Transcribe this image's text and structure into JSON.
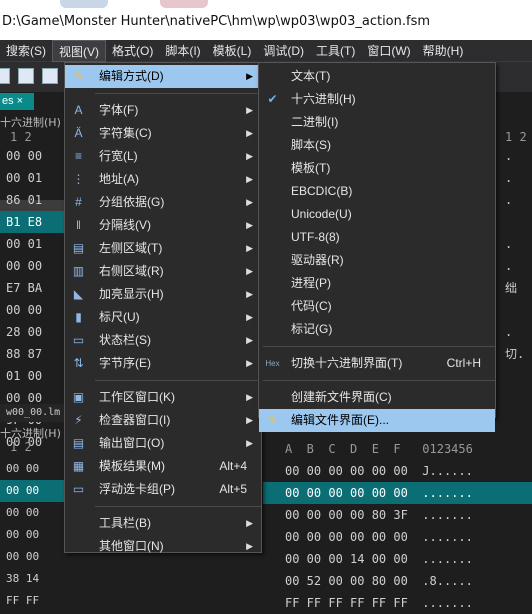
{
  "window": {
    "path": "D:\\Game\\Monster Hunter\\nativePC\\hm\\wp\\wp03\\wp03_action.fsm"
  },
  "menubar": [
    "搜索(S)",
    "视图(V)",
    "格式(O)",
    "脚本(I)",
    "模板(L)",
    "调试(D)",
    "工具(T)",
    "窗口(W)",
    "帮助(H)"
  ],
  "doc_tab": "es ×",
  "top_pane": {
    "label": "十六进制(H)",
    "col_header": "1  2",
    "rows": [
      "00 00",
      "00 01",
      "86 01",
      "B1 E8",
      "00 01",
      "00 00",
      "E7 BA",
      "00 00",
      "28 00",
      "88 87",
      "01 00",
      "00 00",
      "9F 00",
      "00 00"
    ],
    "right_chars": [
      ".",
      ".",
      ".",
      "",
      ".",
      ".",
      "绌",
      "",
      ".",
      "切.",
      "",
      "",
      "",
      ""
    ],
    "right_header": "1 2"
  },
  "file_tab": "w00_00.lm",
  "bottom_pane": {
    "label": "十六进制(H)",
    "left_header": "1  2",
    "left_rows": [
      "00 00",
      "00 00",
      "00 00",
      "00 00",
      "00 00",
      "38 14",
      "FF FF"
    ],
    "header": "A  B  C  D  E  F   0123456",
    "rows": [
      "00 00 00 00 00 00  J......",
      "00 00 00 00 00 00  .......",
      "00 00 00 00 80 3F  .......",
      "00 00 00 00 00 00  .......",
      "00 00 00 14 00 00  .......",
      "00 52 00 00 80 00  .8.....",
      "FF FF FF FF FF FF  ......."
    ]
  },
  "view_menu": {
    "items": [
      {
        "label": "编辑方式(D)",
        "icon": "pencil-icon",
        "submenu": true
      },
      {
        "sep": true
      },
      {
        "label": "字体(F)",
        "icon": "font-icon",
        "submenu": true
      },
      {
        "label": "字符集(C)",
        "icon": "charset-icon",
        "submenu": true
      },
      {
        "label": "行宽(L)",
        "icon": "line-width-icon",
        "submenu": true
      },
      {
        "label": "地址(A)",
        "icon": "address-icon",
        "submenu": true
      },
      {
        "label": "分组依据(G)",
        "icon": "group-icon",
        "submenu": true
      },
      {
        "label": "分隔线(V)",
        "icon": "divider-icon",
        "submenu": true
      },
      {
        "label": "左侧区域(T)",
        "icon": "left-area-icon",
        "submenu": true
      },
      {
        "label": "右侧区域(R)",
        "icon": "right-area-icon",
        "submenu": true
      },
      {
        "label": "加亮显示(H)",
        "icon": "highlight-icon",
        "submenu": true
      },
      {
        "label": "标尺(U)",
        "icon": "ruler-icon",
        "submenu": true
      },
      {
        "label": "状态栏(S)",
        "icon": "statusbar-icon",
        "submenu": true
      },
      {
        "label": "字节序(E)",
        "icon": "byteorder-icon",
        "submenu": true
      },
      {
        "sep": true
      },
      {
        "label": "工作区窗口(K)",
        "icon": "workspace-icon",
        "submenu": true
      },
      {
        "label": "检查器窗口(I)",
        "icon": "inspector-icon",
        "submenu": true
      },
      {
        "label": "输出窗口(O)",
        "icon": "output-icon",
        "submenu": true
      },
      {
        "label": "模板结果(M)",
        "icon": "template-results-icon",
        "shortcut": "Alt+4"
      },
      {
        "label": "浮动选卡组(P)",
        "icon": "floating-tabs-icon",
        "shortcut": "Alt+5"
      },
      {
        "sep": true
      },
      {
        "label": "工具栏(B)",
        "submenu": true
      },
      {
        "label": "其他窗口(N)",
        "submenu": true
      }
    ]
  },
  "edit_as_menu": {
    "items": [
      {
        "label": "文本(T)"
      },
      {
        "label": "十六进制(H)",
        "checked": true
      },
      {
        "label": "二进制(I)"
      },
      {
        "label": "脚本(S)"
      },
      {
        "label": "模板(T)"
      },
      {
        "label": "EBCDIC(B)"
      },
      {
        "label": "Unicode(U)"
      },
      {
        "label": "UTF-8(8)"
      },
      {
        "label": "驱动器(R)"
      },
      {
        "label": "进程(P)"
      },
      {
        "label": "代码(C)"
      },
      {
        "label": "标记(G)"
      },
      {
        "sep": true
      },
      {
        "label": "切换十六进制界面(T)",
        "icon": "Hex",
        "shortcut": "Ctrl+H"
      },
      {
        "sep": true
      },
      {
        "label": "创建新文件界面(C)"
      },
      {
        "label": "编辑文件界面(E)...",
        "icon": "pencil-icon",
        "hover": true
      }
    ]
  }
}
